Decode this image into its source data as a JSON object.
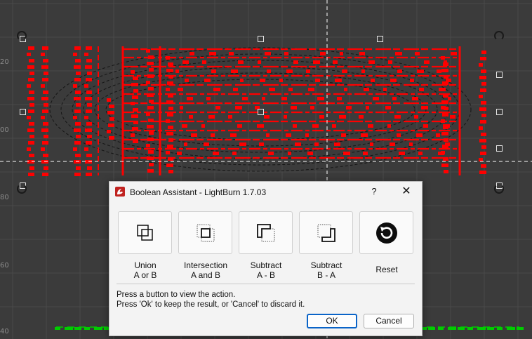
{
  "canvas": {
    "ruler_labels": [
      "20",
      "00",
      "80",
      "60",
      "40"
    ],
    "colors": {
      "background": "#3b3b3b",
      "grid": "#4a4a4a",
      "cut_layer": "#ff0000",
      "engrave_layer": "#00cc00",
      "guide": "#ffffff"
    }
  },
  "dialog": {
    "title": "Boolean Assistant - LightBurn 1.7.03",
    "help_label": "?",
    "close_label": "✕",
    "operations": [
      {
        "id": "union",
        "icon": "union-icon",
        "line1": "Union",
        "line2": "A or B"
      },
      {
        "id": "intersection",
        "icon": "intersection-icon",
        "line1": "Intersection",
        "line2": "A and B"
      },
      {
        "id": "subtract-ab",
        "icon": "subtract-a-b-icon",
        "line1": "Subtract",
        "line2": "A - B"
      },
      {
        "id": "subtract-ba",
        "icon": "subtract-b-a-icon",
        "line1": "Subtract",
        "line2": "B - A"
      },
      {
        "id": "reset",
        "icon": "reset-icon",
        "line1": "",
        "line2": "Reset"
      }
    ],
    "info_line1": "Press a button to view the action.",
    "info_line2": "Press 'Ok' to keep the result, or 'Cancel' to discard it.",
    "ok_label": "OK",
    "cancel_label": "Cancel"
  }
}
